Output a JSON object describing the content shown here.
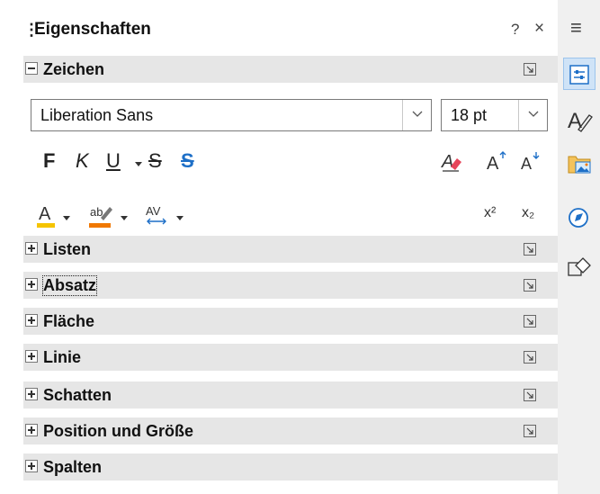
{
  "panel": {
    "title": "Eigenschaften",
    "help_label": "?",
    "close_label": "×"
  },
  "zeichen": {
    "header": "Zeichen",
    "font_name": "Liberation Sans",
    "font_size": "18 pt",
    "bold_label": "F",
    "italic_label": "K",
    "underline_label": "U",
    "strike_label": "S",
    "shadow_label": "S",
    "superscript_label": "x²",
    "subscript_label": "x₂",
    "font_color_label": "A",
    "highlight_label": "ab",
    "spacing_label": "AV",
    "grow_label": "A",
    "shrink_label": "A",
    "font_color": "#f5c400",
    "highlight_color": "#f07800"
  },
  "sections": [
    {
      "label": "Listen"
    },
    {
      "label": "Absatz"
    },
    {
      "label": "Fläche"
    },
    {
      "label": "Linie"
    },
    {
      "label": "Schatten"
    },
    {
      "label": "Position und Größe"
    },
    {
      "label": "Spalten"
    }
  ],
  "sidebar": {
    "menu_label": "≡",
    "active_color": "#cfe3f7"
  }
}
